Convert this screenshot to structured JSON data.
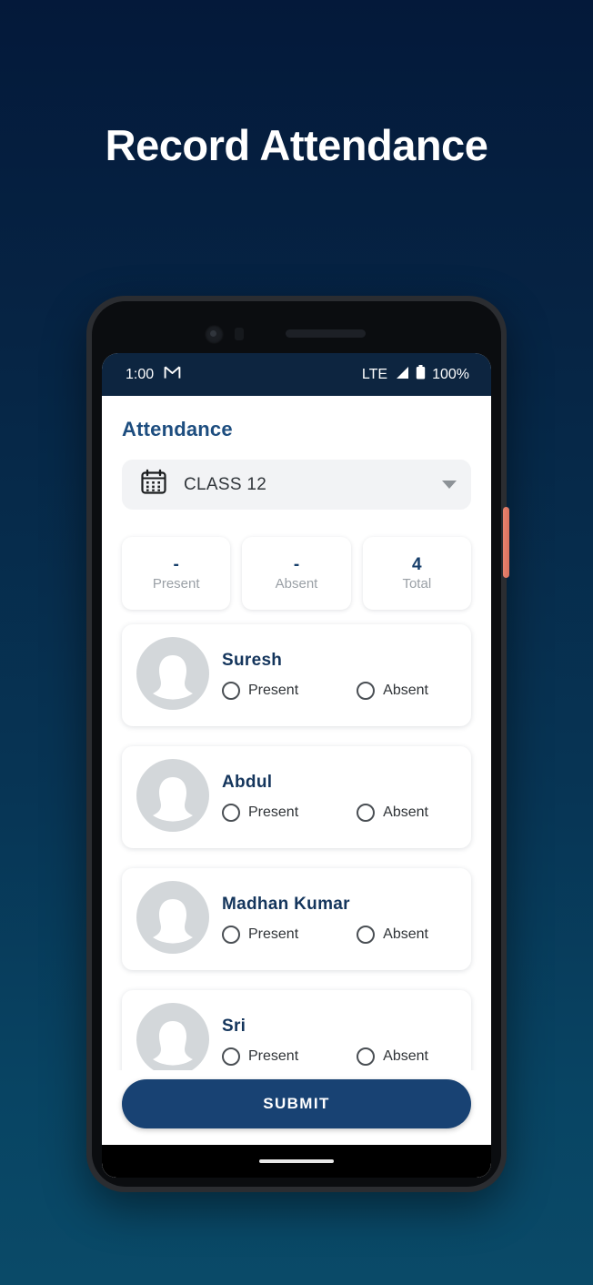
{
  "page": {
    "title": "Record Attendance",
    "background_top": "#04193a",
    "background_bottom": "#0a4a68"
  },
  "device": {
    "power_button_color": "#e8836f",
    "icons": {
      "front_camera": "front-camera-icon",
      "speaker": "earpiece-speaker",
      "home_indicator": "home-indicator"
    }
  },
  "status_bar": {
    "time": "1:00",
    "notification_icon": "gmail-icon",
    "network": "LTE",
    "signal_icon": "signal-icon",
    "battery_icon": "battery-icon",
    "battery_level": "100%",
    "background": "#0d2540"
  },
  "app": {
    "heading": "Attendance",
    "heading_color": "#1d4d7f",
    "class_select": {
      "icon": "calendar-icon",
      "value": "CLASS 12",
      "caret_icon": "chevron-down-icon"
    },
    "stats": [
      {
        "value": "-",
        "label": "Present"
      },
      {
        "value": "-",
        "label": "Absent"
      },
      {
        "value": "4",
        "label": "Total"
      }
    ],
    "students": [
      {
        "name": "Suresh",
        "avatar": "avatar-placeholder",
        "present_label": "Present",
        "absent_label": "Absent",
        "selected": ""
      },
      {
        "name": "Abdul",
        "avatar": "avatar-placeholder",
        "present_label": "Present",
        "absent_label": "Absent",
        "selected": ""
      },
      {
        "name": "Madhan Kumar",
        "avatar": "avatar-placeholder",
        "present_label": "Present",
        "absent_label": "Absent",
        "selected": ""
      },
      {
        "name": "Sri",
        "avatar": "avatar-placeholder",
        "present_label": "Present",
        "absent_label": "Absent",
        "selected": ""
      }
    ],
    "submit_label": "SUBMIT",
    "submit_color": "#184273"
  }
}
